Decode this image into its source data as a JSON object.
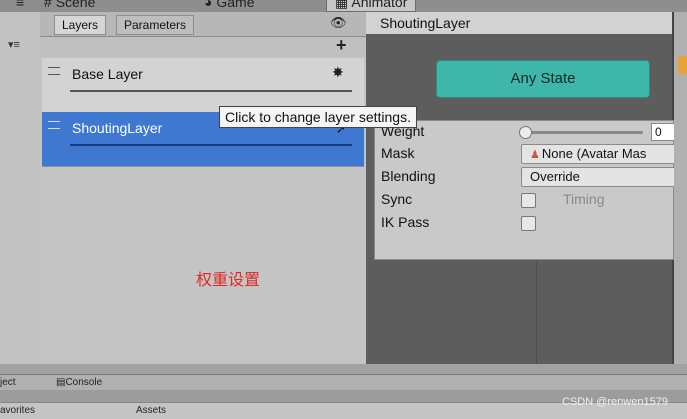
{
  "top_tabs": [
    {
      "label": "Scene",
      "icon": "hash-icon"
    },
    {
      "label": "Game",
      "icon": "pacman-icon"
    },
    {
      "label": "Animator",
      "icon": "animator-icon"
    }
  ],
  "layers_panel": {
    "tabs": [
      "Layers",
      "Parameters"
    ],
    "add_symbol": "+",
    "layers": [
      {
        "name": "Base Layer"
      },
      {
        "name": "ShoutingLayer"
      }
    ]
  },
  "tooltip": "Click to change layer settings.",
  "annotation": "权重设置",
  "right_header": {
    "title": "ShoutingLayer"
  },
  "graph": {
    "any_state": "Any State"
  },
  "layer_settings": {
    "weight_label": "Weight",
    "weight_value": "0",
    "mask_label": "Mask",
    "mask_value": "None (Avatar Mas",
    "blending_label": "Blending",
    "blending_value": "Override",
    "sync_label": "Sync",
    "timing_label": "Timing",
    "ik_pass_label": "IK Pass"
  },
  "bottom": {
    "tab_project": "ject",
    "tab_console": "Console",
    "favorites": "avorites",
    "assets": "Assets"
  },
  "watermark": "CSDN @renwen1579",
  "colors": {
    "selected_layer": "#3f78d0",
    "any_state": "#3fb6aa",
    "annotation": "#e02828"
  }
}
